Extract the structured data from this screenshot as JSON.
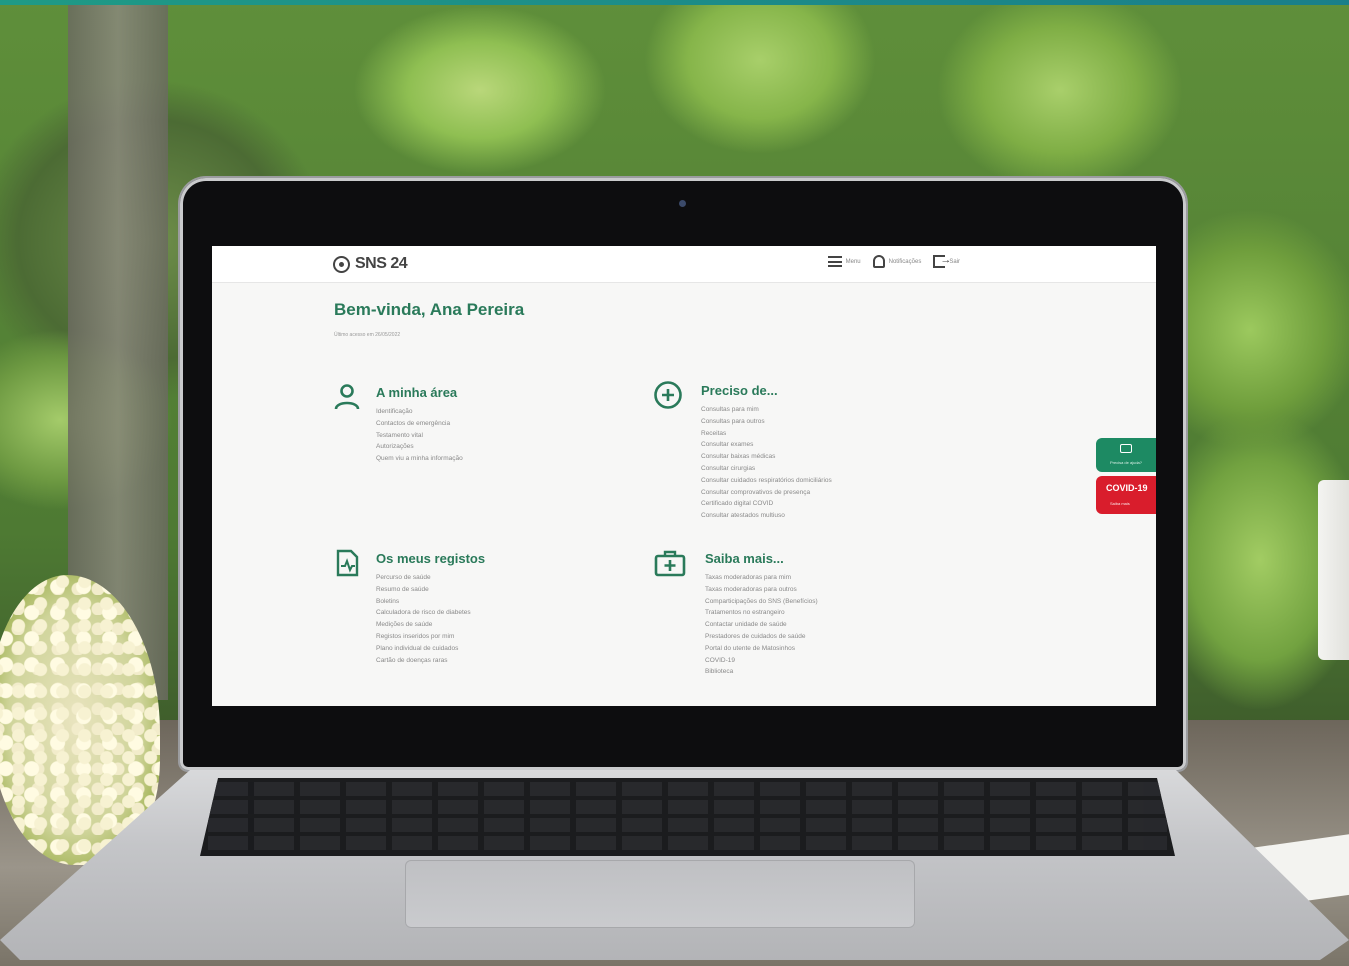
{
  "header": {
    "logo_text": "SNS 24",
    "nav": [
      {
        "label": "Menu",
        "icon": "hamburger-icon"
      },
      {
        "label": "Notificações",
        "icon": "bell-icon"
      },
      {
        "label": "Sair",
        "icon": "exit-icon"
      }
    ]
  },
  "welcome": {
    "title": "Bem-vinda, Ana Pereira",
    "last_access": "Último acesso em 26/05/2022"
  },
  "sections": {
    "minha_area": {
      "title": "A minha área",
      "icon": "person-icon",
      "items": [
        "Identificação",
        "Contactos de emergência",
        "Testamento vital",
        "Autorizações",
        "Quem viu a minha informação"
      ]
    },
    "preciso_de": {
      "title": "Preciso de...",
      "icon": "plus-circle-icon",
      "items": [
        "Consultas para mim",
        "Consultas para outros",
        "Receitas",
        "Consultar exames",
        "Consultar baixas médicas",
        "Consultar cirurgias",
        "Consultar cuidados respiratórios domiciliários",
        "Consultar comprovativos de presença",
        "Certificado digital COVID",
        "Consultar atestados multiuso"
      ]
    },
    "meus_registos": {
      "title": "Os meus registos",
      "icon": "document-icon",
      "items": [
        "Percurso de saúde",
        "Resumo de saúde",
        "Boletins",
        "Calculadora de risco de diabetes",
        "Medições de saúde",
        "Registos inseridos por mim",
        "Plano individual de cuidados",
        "Cartão de doenças raras"
      ]
    },
    "saiba_mais": {
      "title": "Saiba mais...",
      "icon": "medical-kit-icon",
      "items": [
        "Taxas moderadoras para mim",
        "Taxas moderadoras para outros",
        "Comparticipações do SNS (Benefícios)",
        "Tratamentos no estrangeiro",
        "Contactar unidade de saúde",
        "Prestadores de cuidados de saúde",
        "Portal do utente de Matosinhos",
        "COVID-19",
        "Biblioteca"
      ]
    }
  },
  "side_tabs": {
    "help_label": "Precisa de ajuda?",
    "covid_title": "COVID-19",
    "covid_sub": "Saiba mais"
  },
  "colors": {
    "brand_green": "#2a7a5a",
    "tab_green": "#1d8a63",
    "tab_red": "#d91d2c"
  }
}
